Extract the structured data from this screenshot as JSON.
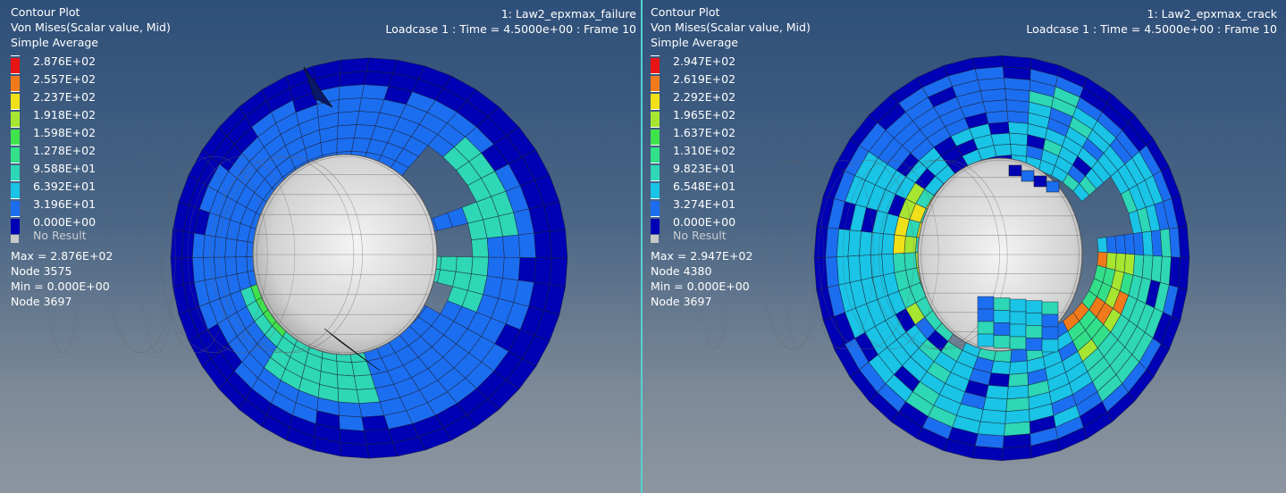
{
  "colors": {
    "legend": [
      "#0000b4",
      "#1c6ef0",
      "#19c4e6",
      "#2ed7b5",
      "#33e08a",
      "#3fe34c",
      "#a6e631",
      "#f0e019",
      "#f07a19",
      "#e81414"
    ],
    "no_result": "#c8c8c8",
    "mesh_line": "#1c2233",
    "sphere": "#d4d4d4",
    "divider": "#55d0d0"
  },
  "panels": [
    {
      "header": {
        "line1": "Contour Plot",
        "line2": "Von Mises(Scalar value, Mid)",
        "line3": "Simple Average"
      },
      "model_title": "1: Law2_epxmax_failure",
      "loadcase": "Loadcase 1 : Time = 4.5000e+00 : Frame 10",
      "legend_values": [
        "2.876E+02",
        "2.557E+02",
        "2.237E+02",
        "1.918E+02",
        "1.598E+02",
        "1.278E+02",
        "9.588E+01",
        "6.392E+01",
        "3.196E+01",
        "0.000E+00"
      ],
      "no_result": "No Result",
      "max_line": "Max =  2.876E+02",
      "max_node": "Node 3575",
      "min_line": "Min =  0.000E+00",
      "min_node": "Node 3697"
    },
    {
      "header": {
        "line1": "Contour Plot",
        "line2": "Von Mises(Scalar value, Mid)",
        "line3": "Simple Average"
      },
      "model_title": "1: Law2_epxmax_crack",
      "loadcase": "Loadcase 1 : Time = 4.5000e+00 : Frame 10",
      "legend_values": [
        "2.947E+02",
        "2.619E+02",
        "2.292E+02",
        "1.965E+02",
        "1.637E+02",
        "1.310E+02",
        "9.823E+01",
        "6.548E+01",
        "3.274E+01",
        "0.000E+00"
      ],
      "no_result": "No Result",
      "max_line": "Max =  2.947E+02",
      "max_node": "Node 4380",
      "min_line": "Min =  0.000E+00",
      "min_node": "Node 3697"
    }
  ]
}
